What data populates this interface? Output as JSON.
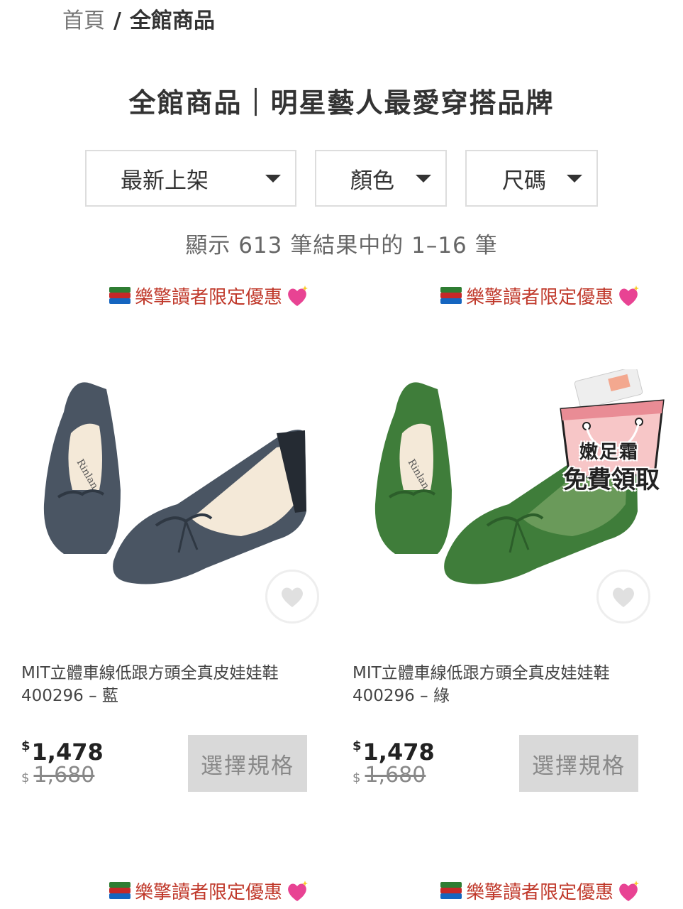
{
  "breadcrumb": {
    "home": "首頁",
    "separator": "/",
    "current": "全館商品"
  },
  "title": "全館商品｜明星藝人最愛穿搭品牌",
  "filters": {
    "sort": "最新上架",
    "color": "顏色",
    "size": "尺碼"
  },
  "result_count": "顯示 613 筆結果中的 1–16 筆",
  "promo_label": "樂擎讀者限定優惠",
  "promo_icons": {
    "left": "books-icon",
    "right": "sparkling-heart-icon"
  },
  "products": [
    {
      "name_line1": "MIT立體車線低跟方頭全真皮娃娃鞋",
      "name_line2": "400296 – 藍",
      "currency": "$",
      "price": "1,478",
      "original_price": "1,680",
      "button": "選擇規格",
      "shoe_color": "#4a5563"
    },
    {
      "name_line1": "MIT立體車線低跟方頭全真皮娃娃鞋",
      "name_line2": "400296 – 綠",
      "currency": "$",
      "price": "1,478",
      "original_price": "1,680",
      "button": "選擇規格",
      "shoe_color": "#3f7d3a",
      "badge": {
        "line1": "嫩足霜",
        "line2": "免費領取"
      }
    }
  ]
}
